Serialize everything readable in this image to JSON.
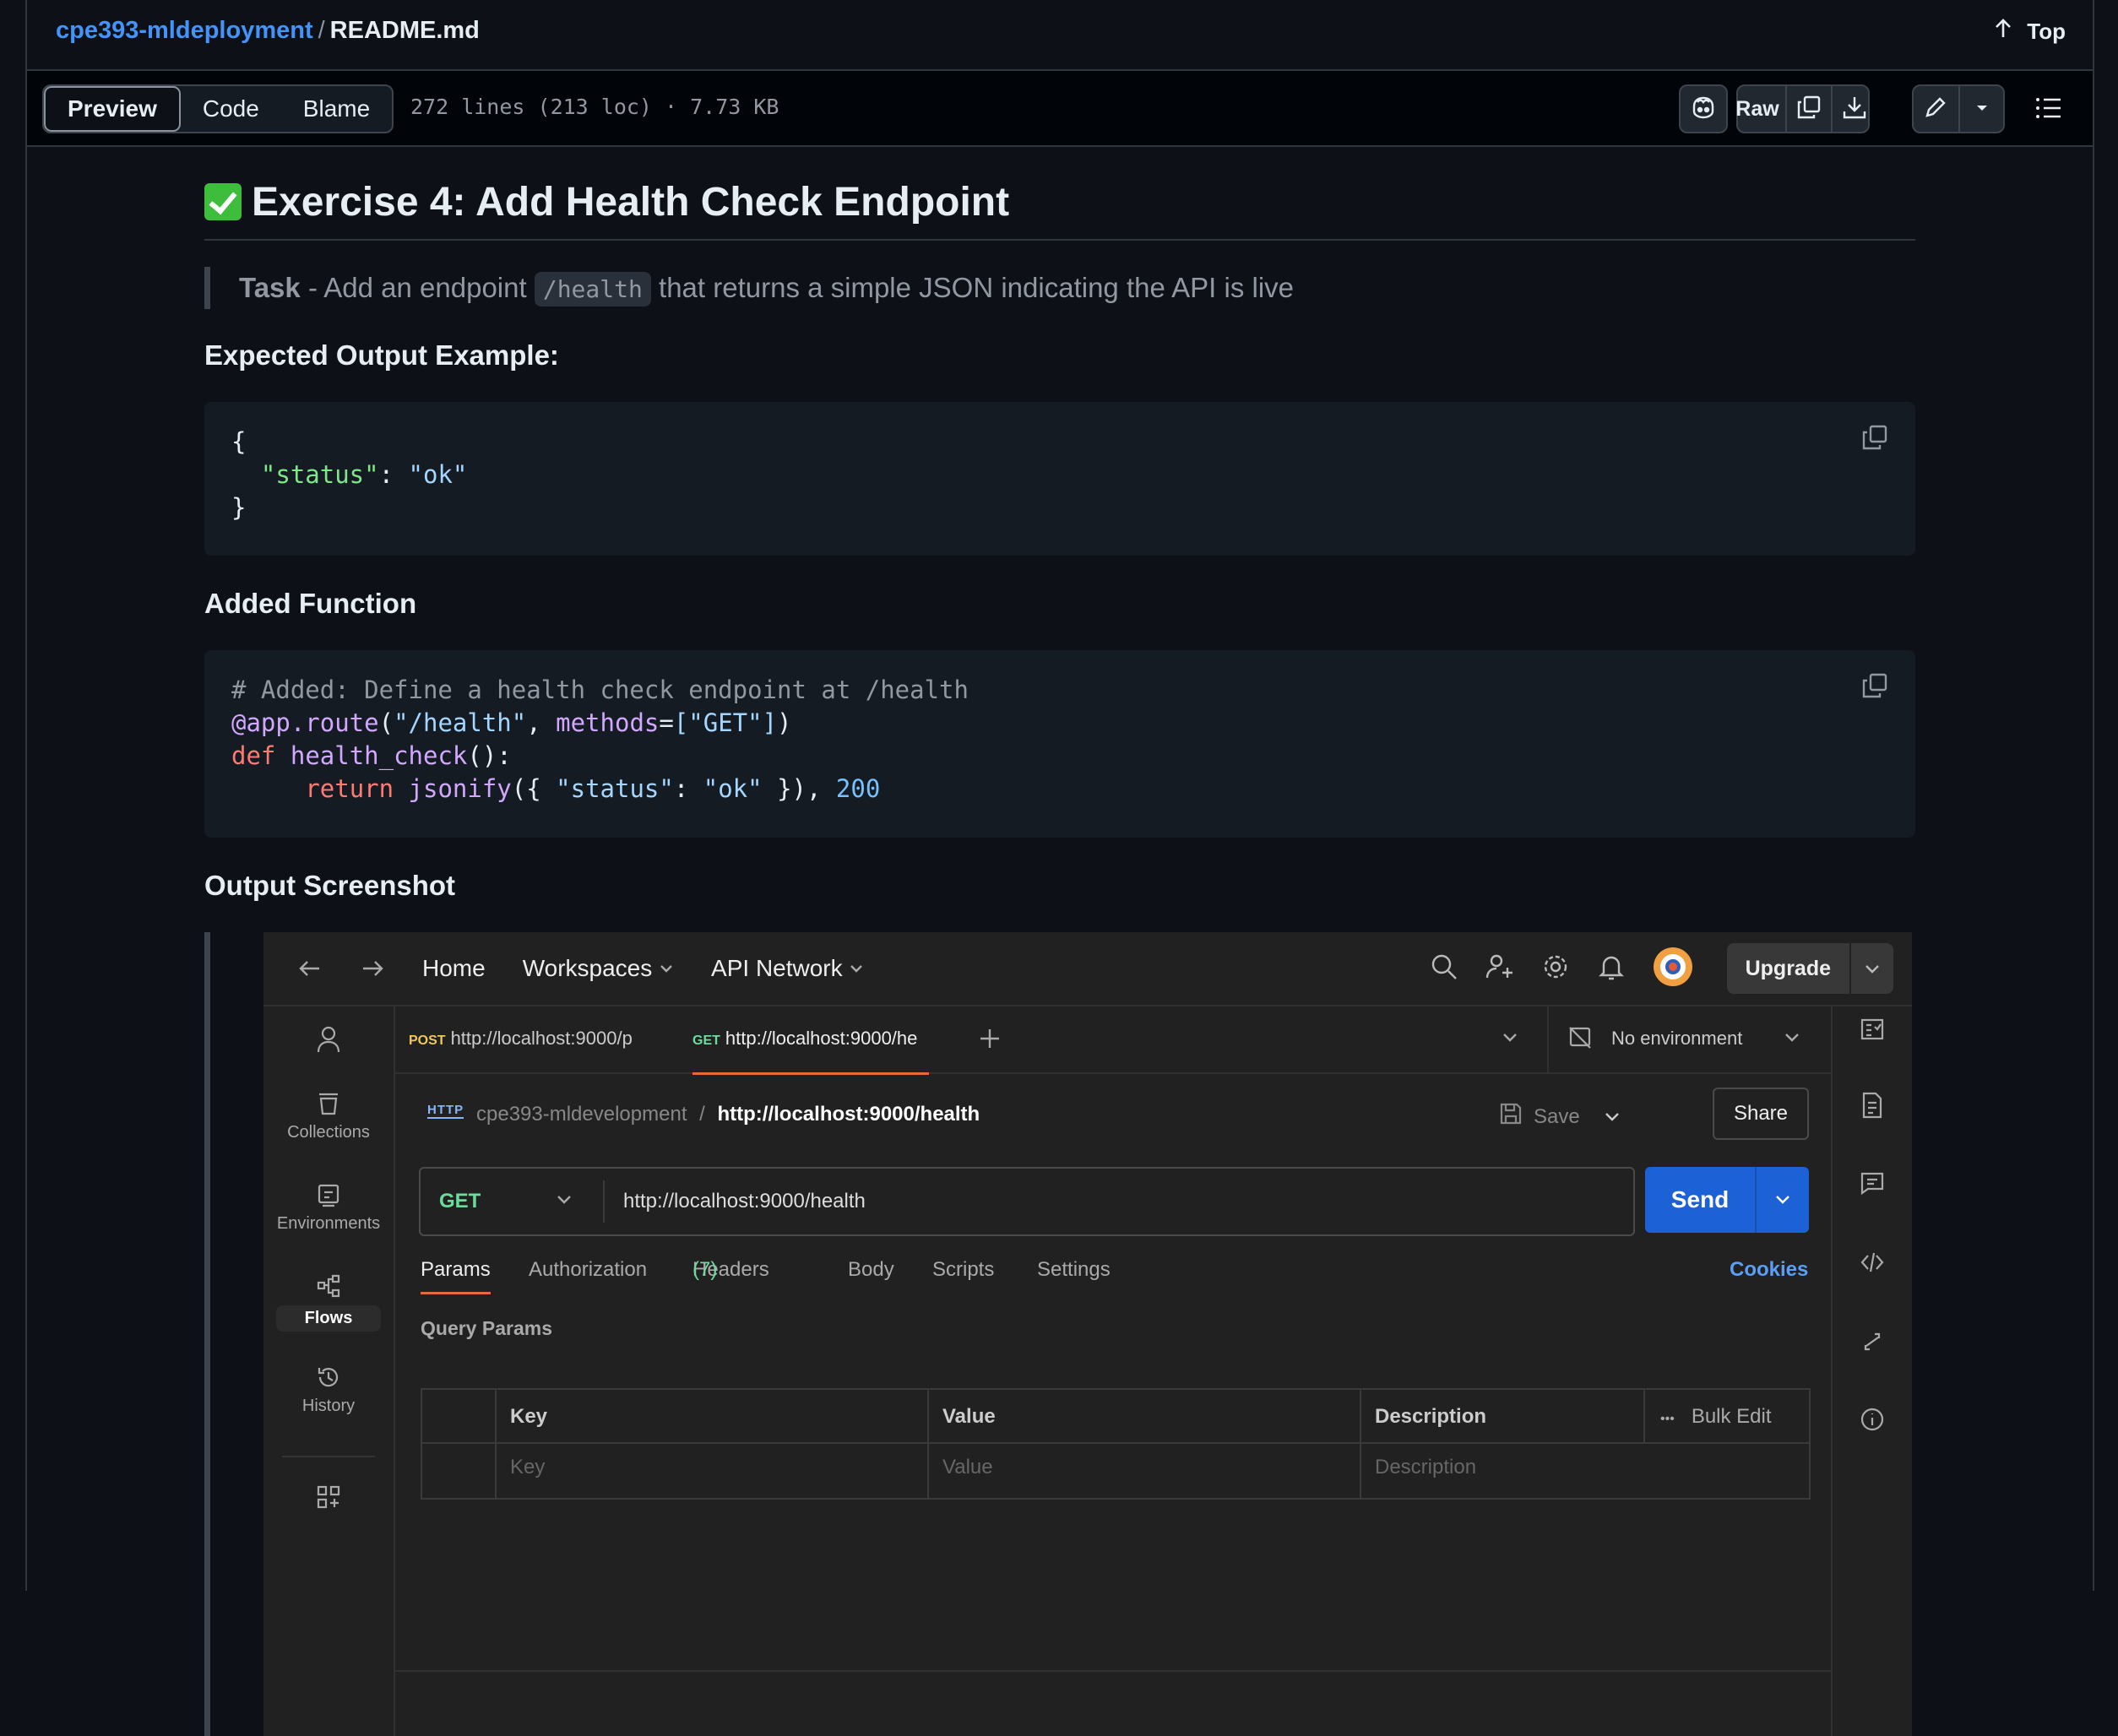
{
  "header": {
    "repo": "cpe393-mldeployment",
    "separator": "/",
    "file": "README.md",
    "top_label": "Top"
  },
  "toolbar": {
    "tabs": [
      "Preview",
      "Code",
      "Blame"
    ],
    "file_info": "272 lines (213 loc) · 7.73 KB",
    "raw_label": "Raw"
  },
  "readme": {
    "title": "Exercise 4: Add Health Check Endpoint",
    "task_bold": "Task",
    "task_pre": " - Add an endpoint ",
    "task_code": "/health",
    "task_post": " that returns a simple JSON indicating the API is live",
    "expected_heading": "Expected Output Example:",
    "json_lines": [
      "{",
      "\"status\"",
      ": ",
      "\"ok\"",
      "}"
    ],
    "function_heading": "Added Function",
    "code": {
      "comment": "# Added: Define a health check endpoint at /health",
      "decorator": "@app.route",
      "route_arg": "\"/health\"",
      "methods_kw": "methods",
      "methods_val": "[\"GET\"]",
      "def_kw": "def",
      "fn_name": "health_check",
      "return_kw": "return",
      "jsonify": "jsonify",
      "status_key": "\"status\"",
      "status_val": "\"ok\"",
      "status_code": "200"
    },
    "screenshot_heading": "Output Screenshot"
  },
  "postman": {
    "nav": [
      "Home",
      "Workspaces",
      "API Network"
    ],
    "upgrade": "Upgrade",
    "sidebar": [
      "Collections",
      "Environments",
      "Flows",
      "History"
    ],
    "tabs": [
      {
        "method": "POST",
        "url": "http://localhost:9000/p"
      },
      {
        "method": "GET",
        "url": "http://localhost:9000/he"
      }
    ],
    "environment": "No environment",
    "breadcrumb_collection": "cpe393-mldevelopment",
    "breadcrumb_sep": "/",
    "breadcrumb_request": "http://localhost:9000/health",
    "save": "Save",
    "share": "Share",
    "method": "GET",
    "url": "http://localhost:9000/health",
    "send": "Send",
    "request_tabs": [
      "Params",
      "Authorization",
      "Headers",
      "Body",
      "Scripts",
      "Settings"
    ],
    "headers_count": "(7)",
    "cookies": "Cookies",
    "query_params": "Query Params",
    "columns": [
      "Key",
      "Value",
      "Description"
    ],
    "bulk_edit": "Bulk Edit",
    "placeholders": [
      "Key",
      "Value",
      "Description"
    ],
    "http_badge": "HTTP"
  }
}
